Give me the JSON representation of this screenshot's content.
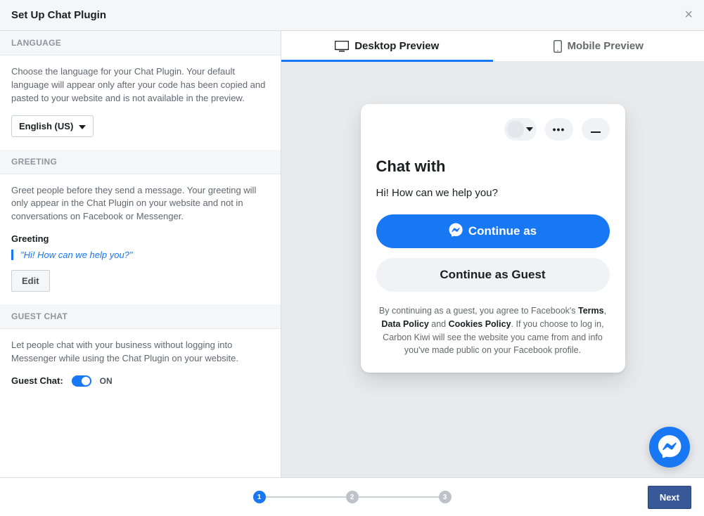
{
  "header": {
    "title": "Set Up Chat Plugin"
  },
  "sections": {
    "language": {
      "heading": "LANGUAGE",
      "desc": "Choose the language for your Chat Plugin. Your default language will appear only after your code has been copied and pasted to your website and is not available in the preview.",
      "selected": "English (US)"
    },
    "greeting": {
      "heading": "GREETING",
      "desc": "Greet people before they send a message. Your greeting will only appear in the Chat Plugin on your website and not in conversations on Facebook or Messenger.",
      "label": "Greeting",
      "text": "\"Hi! How can we help you?\"",
      "edit_label": "Edit"
    },
    "guest": {
      "heading": "GUEST CHAT",
      "desc": "Let people chat with your business without logging into Messenger while using the Chat Plugin on your website.",
      "toggle_label": "Guest Chat:",
      "toggle_state": "ON",
      "toggle_on": true
    }
  },
  "tabs": {
    "desktop": "Desktop Preview",
    "mobile": "Mobile Preview",
    "active": "desktop"
  },
  "preview": {
    "chat_title": "Chat with",
    "greeting": "Hi! How can we help you?",
    "continue_as": "Continue as",
    "continue_guest": "Continue as Guest",
    "disclaimer_pre": "By continuing as a guest, you agree to Facebook's ",
    "terms": "Terms",
    "comma": ", ",
    "data_policy": "Data Policy",
    "and": " and ",
    "cookies_policy": "Cookies Policy",
    "disclaimer_post": ". If you choose to log in, Carbon Kiwi will see the website you came from and info you've made public on your Facebook profile."
  },
  "stepper": {
    "steps": [
      "1",
      "2",
      "3"
    ],
    "current": 1
  },
  "footer": {
    "next": "Next"
  }
}
